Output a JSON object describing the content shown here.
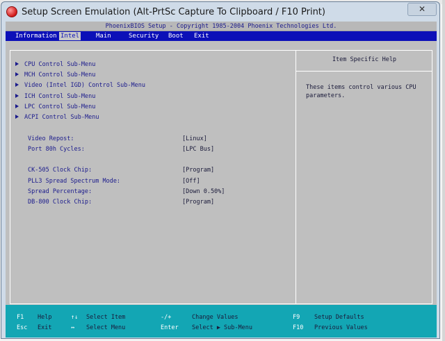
{
  "window": {
    "title": "Setup Screen Emulation (Alt-PrtSc Capture To Clipboard / F10 Print)",
    "close_symbol": "✕"
  },
  "bios": {
    "copyright": "PhoenixBIOS Setup - Copyright 1985-2004 Phoenix Technologies Ltd.",
    "menu": [
      "Information",
      "Intel",
      "Main",
      "Security",
      "Boot",
      "Exit"
    ],
    "active_menu": "Intel",
    "submenus": [
      "CPU Control Sub-Menu",
      "MCH Control Sub-Menu",
      "Video (Intel IGD) Control Sub-Menu",
      "ICH Control Sub-Menu",
      "LPC Control Sub-Menu",
      "ACPI Control Sub-Menu"
    ],
    "settings": [
      {
        "label": "Video Repost:",
        "value": "[Linux]"
      },
      {
        "label": "Port 80h Cycles:",
        "value": "[LPC Bus]"
      },
      {
        "label": "CK-505 Clock Chip:",
        "value": "[Program]"
      },
      {
        "label": "PLL3 Spread Spectrum Mode:",
        "value": "[Off]"
      },
      {
        "label": "Spread Percentage:",
        "value": "[Down 0.50%]"
      },
      {
        "label": "DB-800 Clock Chip:",
        "value": "[Program]"
      }
    ],
    "help": {
      "title": "Item Specific Help",
      "text": "These items control various CPU parameters."
    },
    "footer": [
      {
        "key": "F1",
        "desc": "Help"
      },
      {
        "key": "↑↓",
        "desc": "Select Item"
      },
      {
        "key": "-/+",
        "desc": "Change Values"
      },
      {
        "key": "F9",
        "desc": "Setup Defaults"
      },
      {
        "key": "Esc",
        "desc": "Exit"
      },
      {
        "key": "↔",
        "desc": "Select Menu"
      },
      {
        "key": "Enter",
        "desc": "Select ▶ Sub-Menu"
      },
      {
        "key": "F10",
        "desc": "Previous Values"
      }
    ]
  },
  "colors": {
    "menubar": "#0c10b8",
    "footer": "#13a6b4",
    "screen": "#bfbfbf",
    "text": "#1a1a8c"
  }
}
